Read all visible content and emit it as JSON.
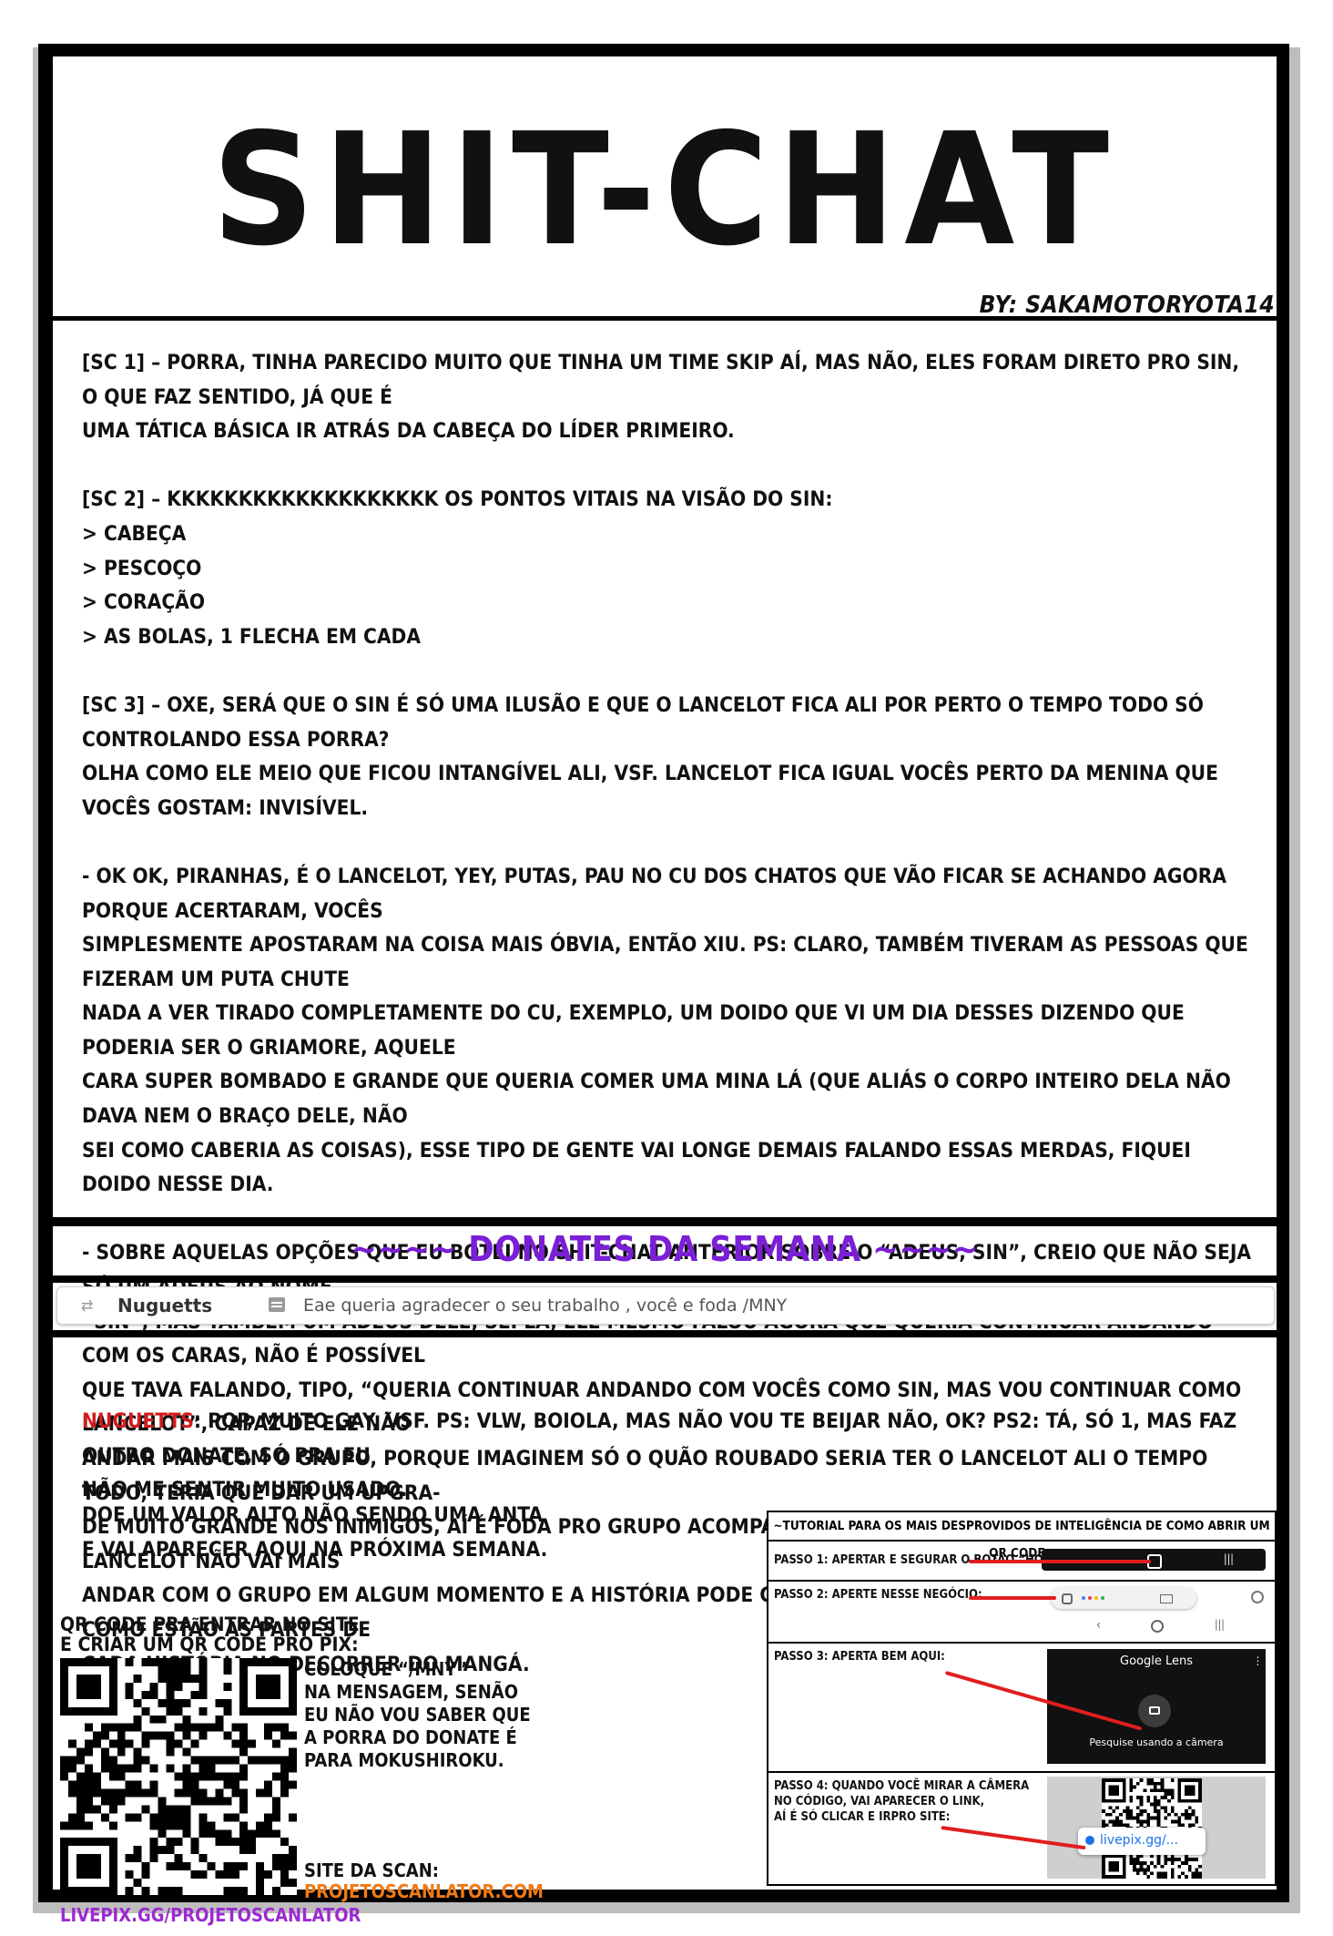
{
  "header": {
    "title": "SHIT-CHAT",
    "byline": "BY: SAKAMOTORYOTA14"
  },
  "paragraphs": [
    [
      "[SC 1] – PORRA, TINHA PARECIDO MUITO QUE TINHA UM TIME SKIP AÍ, MAS NÃO, ELES FORAM DIRETO PRO SIN, O QUE FAZ SENTIDO, JÁ QUE É",
      "UMA TÁTICA BÁSICA IR ATRÁS DA CABEÇA DO LÍDER PRIMEIRO."
    ],
    [
      "[SC 2] – KKKKKKKKKKKKKKKKKKK OS PONTOS VITAIS NA VISÃO DO SIN:",
      "> CABEÇA",
      "> PESCOÇO",
      "> CORAÇÃO",
      "> AS BOLAS, 1 FLECHA EM CADA"
    ],
    [
      "[SC 3] – OXE, SERÁ QUE O SIN É SÓ UMA ILUSÃO E QUE O LANCELOT FICA ALI POR PERTO O TEMPO TODO SÓ CONTROLANDO ESSA PORRA?",
      "OLHA COMO ELE MEIO QUE FICOU INTANGÍVEL ALI, VSF. LANCELOT FICA IGUAL VOCÊS PERTO DA MENINA QUE VOCÊS GOSTAM: INVISÍVEL."
    ],
    [
      "- OK OK, PIRANHAS, É O LANCELOT, YEY, PUTAS, PAU NO CU DOS CHATOS QUE VÃO FICAR SE ACHANDO AGORA PORQUE ACERTARAM, VOCÊS",
      "SIMPLESMENTE APOSTARAM NA COISA MAIS ÓBVIA, ENTÃO XIU. PS: CLARO, TAMBÉM TIVERAM AS PESSOAS QUE FIZERAM UM PUTA CHUTE",
      "NADA A VER TIRADO COMPLETAMENTE DO CU, EXEMPLO, UM DOIDO QUE VI UM DIA DESSES DIZENDO QUE PODERIA SER O GRIAMORE, AQUELE",
      "CARA SUPER BOMBADO E GRANDE QUE QUERIA COMER UMA MINA LÁ (QUE ALIÁS O CORPO INTEIRO DELA NÃO DAVA NEM O BRAÇO DELE, NÃO",
      "SEI COMO CABERIA AS COISAS), ESSE TIPO DE GENTE VAI LONGE DEMAIS FALANDO ESSAS MERDAS, FIQUEI DOIDO NESSE DIA."
    ],
    [
      "- SOBRE AQUELAS OPÇÕES QUE EU BOTEI NO SHIT-CHAT ANTERIOR SOBRE O “ADEUS, SIN”, CREIO QUE NÃO SEJA SÓ UM ADEUS AO NOME",
      "“SIN”, MAS TAMBÉM UM ADEUS DELE, SEI LÁ, ELE MESMO FALOU AGORA QUE QUERIA CONTINUAR ANDANDO COM OS CARAS, NÃO É POSSÍVEL",
      "QUE TAVA FALANDO, TIPO, “QUERIA CONTINUAR ANDANDO COM VOCÊS COMO SIN, MAS VOU CONTINUAR COMO LANCELOT”, CAPAZ DE ELE NÃO",
      "ANDAR MAIS COM O GRUPO, PORQUE IMAGINEM SÓ O QUÃO ROUBADO SERIA TER O LANCELOT ALI O TEMPO TODO, TERIA QUE DAR UM UPGRA-",
      "DE MUITO GRANDE NOS INIMIGOS, AÍ É FODA PRO GRUPO ACOMPANHAR, ENTÃO É ISSO, MINHA TEORIA É QUE O LANCELOT NÃO VAI MAIS",
      "ANDAR COM O GRUPO EM ALGUM MOMENTO E A HISTÓRIA PODE COMEÇAR A SE DIVIDIR MAIS E IR MOSTRANDO COMO ESTÃO AS PARTES DE",
      "CADA HISTÓRIA NO DECORRER DO MANGÁ."
    ]
  ],
  "donates": {
    "title": "~~~~ DONATES DA SEMANA ~~~~",
    "card": {
      "name": "Nuguetts",
      "message": "Eae queria agradecer o seu trabalho , você e foda /MNY"
    },
    "reply_name": "NUGUETTS",
    "reply_lines": [
      ": PQP, MUITO GAY, VSF. PS: VLW, BOIOLA, MAS NÃO VOU TE BEIJAR NÃO, OK? PS2: TÁ, SÓ 1, MAS FAZ OUTRO DONATE, SÓ PRA EU",
      "NÃO ME SENTIR MUITO USADO."
    ],
    "call_lines": [
      "DOE UM VALOR ALTO NÃO SENDO UMA ANTA",
      "E VAI APARECER AQUI NA PRÓXIMA SEMANA."
    ]
  },
  "qr": {
    "caption_lines": [
      "QR CODE PRA ENTRAR NO SITE",
      "E CRIAR UM QR CODE PRO PIX:"
    ],
    "instructions": [
      "COLOQUE “/MNY”",
      "NA MENSAGEM, SENÃO",
      "EU NÃO VOU SABER QUE",
      "A PORRA DO DONATE É",
      "PARA MOKUSHIROKU."
    ],
    "site_label": "SITE DA SCAN:",
    "site_link": "PROJETOSCANLATOR.COM",
    "livepix": "LIVEPIX.GG/PROJETOSCANLATOR"
  },
  "tutorial": {
    "title": "~TUTORIAL PARA OS MAIS DESPROVIDOS DE INTELIGÊNCIA DE COMO ABRIR UM QR CODE~",
    "step1": "PASSO 1: APERTAR E SEGURAR O BOTÃO “HOME”:",
    "step2": "PASSO 2: APERTE NESSE NEGÓCIO:",
    "step3": "PASSO 3: APERTA BEM AQUI:",
    "step3_lens_title": "Google Lens",
    "step3_lens_sub": "Pesquise usando a câmera",
    "step4_lines": [
      "PASSO 4: QUANDO VOCÊ MIRAR A CÂMERA",
      "NO CÓDIGO, VAI APARECER O LINK,",
      "AÍ É SÓ CLICAR E IRPRO SITE:"
    ],
    "step4_link": "livepix.gg/..."
  },
  "colors": {
    "accent_purple": "#7a1fd6",
    "name_red": "#d21c1c",
    "link_orange": "#f07a16",
    "livepix_purple": "#9b2ad1",
    "arrow_red": "#e01e1e"
  }
}
